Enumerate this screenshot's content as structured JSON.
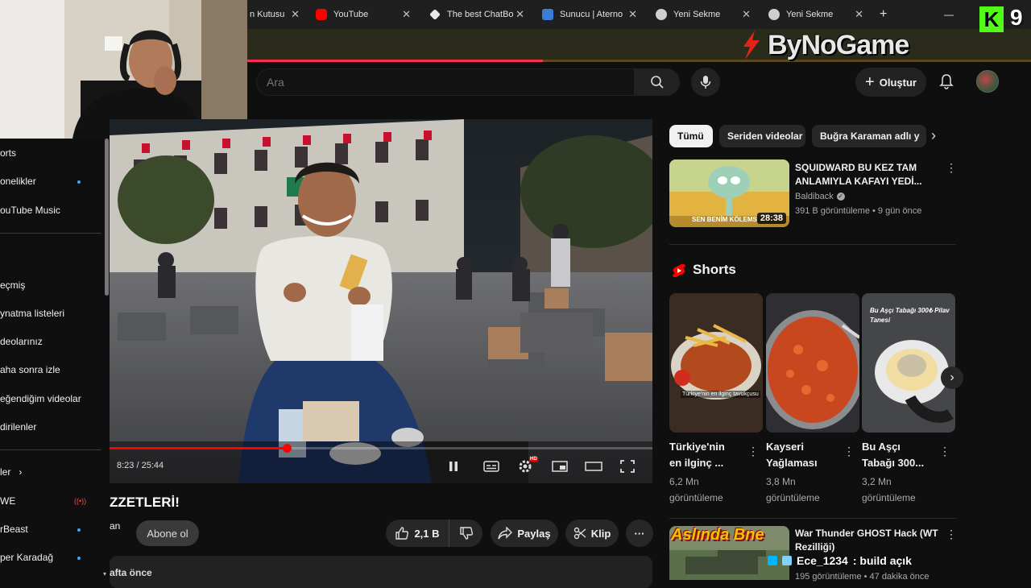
{
  "browser": {
    "tabs": [
      {
        "label": "n Kutusu",
        "favicon_color": "#ffffff"
      },
      {
        "label": "YouTube",
        "favicon_color": "#ff0000"
      },
      {
        "label": "The best ChatBo",
        "favicon_color": "#e8e8e8"
      },
      {
        "label": "Sunucu | Aterno",
        "favicon_color": "#3a7bd5"
      },
      {
        "label": "Yeni Sekme",
        "favicon_color": "#cfcfcf"
      },
      {
        "label": "Yeni Sekme",
        "favicon_color": "#cfcfcf"
      }
    ],
    "new_tab_glyph": "+",
    "minimize_glyph": "—"
  },
  "overlay": {
    "bynogame_text": "ByNoGame",
    "kick_letter": "K",
    "kick_count": "9",
    "chat_user": "Ece_1234",
    "chat_message": ": build açık"
  },
  "header": {
    "search_placeholder": "Ara",
    "create_label": "Oluştur"
  },
  "sidebar": {
    "items": [
      {
        "label": "orts"
      },
      {
        "label": "onelikler",
        "dot": true
      },
      {
        "label": "ouTube Music"
      },
      {
        "label": "eçmiş"
      },
      {
        "label": "ynatma listeleri"
      },
      {
        "label": "deolarınız"
      },
      {
        "label": "aha sonra izle"
      },
      {
        "label": "eğendiğim videolar"
      },
      {
        "label": "dirilenler"
      },
      {
        "label": "ler"
      },
      {
        "label": "WE",
        "live": true
      },
      {
        "label": "rBeast",
        "dot": true
      },
      {
        "label": "per Karadağ",
        "dot": true
      }
    ]
  },
  "player": {
    "current_time": "8:23",
    "duration": "25:44",
    "time_display": "8:23 / 25:44",
    "progress": 0.326,
    "hd_badge": "HD"
  },
  "video": {
    "title": "ZZETLERİ!",
    "channel": "an",
    "subscribe_label": "Abone ol",
    "likes": "2,1 B",
    "share_label": "Paylaş",
    "clip_label": "Klip",
    "date_fragment": "afta önce"
  },
  "chips": [
    {
      "label": "Tümü",
      "active": true
    },
    {
      "label": "Seriden videolar"
    },
    {
      "label": "Buğra Karaman adlı y"
    }
  ],
  "recommended": [
    {
      "title_line1": "SQUIDWARD BU KEZ TAM",
      "title_line2": "ANLAMIYLA KAFAYI YEDİ...",
      "channel": "Baldiback",
      "meta": "391 B görüntüleme • 9 gün önce",
      "duration": "28:38",
      "thumb_caption": "SEN BENİM KÖLEMS"
    },
    {
      "title_line1": "War Thunder GHOST Hack (WT",
      "title_line2": "Rezilliği)",
      "meta": "195 görüntüleme • 47 dakika önce",
      "thumb_caption": "Aslında Bne"
    }
  ],
  "shorts": {
    "heading": "Shorts",
    "items": [
      {
        "title_line1": "Türkiye'nin",
        "title_line2": "en ilginç ...",
        "views_line1": "6,2 Mn",
        "views_line2": "görüntüleme",
        "caption": "Türkiye'nin en ilginç tavukçusu"
      },
      {
        "title_line1": "Kayseri",
        "title_line2": "Yağlaması",
        "views_line1": "3,8 Mn",
        "views_line2": "görüntüleme"
      },
      {
        "title_line1": "Bu Aşçı",
        "title_line2": "Tabağı 300...",
        "views_line1": "3,2 Mn",
        "views_line2": "görüntüleme",
        "caption": "Bu Aşçı Tabağı 300₺ Pilav Tanesi"
      }
    ]
  }
}
